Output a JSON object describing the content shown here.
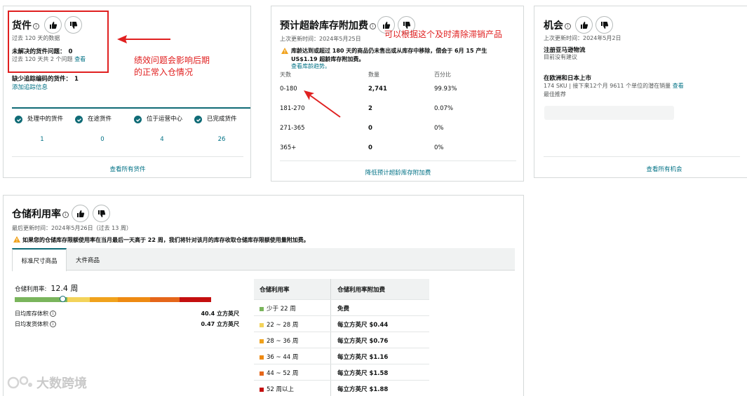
{
  "shipments": {
    "title": "货件",
    "subtitle": "过去 120 天的数据",
    "unresolved_label": "未解决的货件问题：",
    "unresolved_count": "0",
    "past_issues": "过去 120 天共 2 个问题",
    "view_link": "查看",
    "missing_label": "缺少追踪编码的货件：",
    "missing_count": "1",
    "add_tracking": "添加追踪信息",
    "statuses": [
      {
        "label": "处理中的货件",
        "count": "1"
      },
      {
        "label": "在途货件",
        "count": "0"
      },
      {
        "label": "位于运营中心",
        "count": "4"
      },
      {
        "label": "已完成货件",
        "count": "26"
      }
    ],
    "view_all": "查看所有货件",
    "accent_color": "#0f6b76"
  },
  "aged_inventory": {
    "title": "预计超龄库存附加费",
    "updated": "上次更新时间：2024年5月25日",
    "warning_line1": "库龄达到或超过 180 天的商品仍未售出或从库存中移除，偿会于 6月 15 产生",
    "warning_line2": "US$1.19 超龄库存附加费。",
    "view_age_link": "查看库龄趋势。",
    "headers": [
      "天数",
      "数量",
      "百分比"
    ],
    "rows": [
      {
        "days": "0-180",
        "qty": "2,741",
        "pct": "99.93%"
      },
      {
        "days": "181-270",
        "qty": "2",
        "pct": "0.07%"
      },
      {
        "days": "271-365",
        "qty": "0",
        "pct": "0%"
      },
      {
        "days": "365+",
        "qty": "0",
        "pct": "0%"
      }
    ],
    "footer_link": "降低预计超龄库存附加费"
  },
  "opportunities": {
    "title": "机会",
    "updated": "上次更新时间：2024年5月2日",
    "item1_title": "注册亚马逊物流",
    "item1_desc": "目前没有建议",
    "item2_title": "在欧洲和日本上市",
    "item2_desc": "174 SKU | 接下来12个月 9611 个单位的潜在销量",
    "item2_link": "查看",
    "item2_sub": "最佳推荐",
    "view_all": "查看所有机会"
  },
  "storage": {
    "title": "仓储利用率",
    "updated": "最后更新时间：2024年5月26日（过去 13 周）",
    "warning": "如果您的仓储库存限额使用率在当月最后一天高于 22 周，我们将针对该月的库存收取仓储库存限额使用量附加费。",
    "tabs": [
      "标准尺寸商品",
      "大件商品"
    ],
    "ratio_label": "仓储利用率:",
    "ratio_value": "12.4 周",
    "daily_inventory_label": "日均库存体积",
    "daily_inventory_value": "40.4 立方英尺",
    "daily_shipped_label": "日均发货体积",
    "daily_shipped_value": "0.47 立方英尺",
    "table_headers": [
      "仓储利用率",
      "仓储利用率附加费"
    ],
    "table_rows": [
      {
        "range": "少于 22 周",
        "fee": "免费",
        "color": "#7ab55c"
      },
      {
        "range": "22 ~ 28 周",
        "fee": "每立方英尺 $0.44",
        "color": "#f3d35a"
      },
      {
        "range": "28 ~ 36 周",
        "fee": "每立方英尺 $0.76",
        "color": "#f0a21c"
      },
      {
        "range": "36 ~ 44 周",
        "fee": "每立方英尺 $1.16",
        "color": "#ee8a12"
      },
      {
        "range": "44 ~ 52 周",
        "fee": "每立方英尺 $1.58",
        "color": "#e5661a"
      },
      {
        "range": "52 周以上",
        "fee": "每立方英尺 $1.88",
        "color": "#c40f0f"
      }
    ],
    "bar_colors": [
      "#7ab55c",
      "#f3d35a",
      "#f0a21c",
      "#ee8a12",
      "#e5661a",
      "#c40f0f"
    ],
    "bar_marker_fraction": 0.215
  },
  "annotations": {
    "note1_line1": "绩效问题会影响后期",
    "note1_line2": "的正常入仓情况",
    "note2": "可以根据这个及时清除滞销产品"
  },
  "watermark": "大数跨境"
}
